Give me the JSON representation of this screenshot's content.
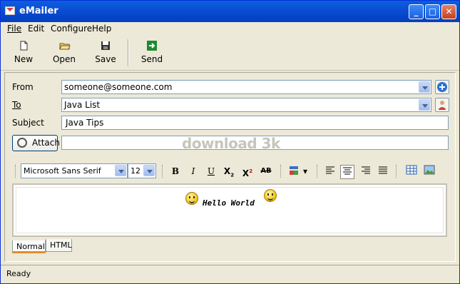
{
  "window": {
    "title": "eMailer"
  },
  "menu": [
    "File",
    "Edit",
    "Configure",
    "Help"
  ],
  "toolbar": {
    "new": "New",
    "open": "Open",
    "save": "Save",
    "send": "Send"
  },
  "form": {
    "from_label": "From",
    "from_value": "someone@someone.com",
    "to_label": "To",
    "to_value": "Java List",
    "subject_label": "Subject",
    "subject_value": "Java Tips",
    "attach_label": "Attach",
    "attach_value": ""
  },
  "watermark": "download 3k",
  "editor_toolbar": {
    "font": "Microsoft Sans Serif",
    "size": "12",
    "bold": "B",
    "italic": "I",
    "underline": "U",
    "subscript": "X",
    "subscript_mark": "2",
    "superscript": "X",
    "superscript_mark": "2",
    "strike": "AB"
  },
  "editor": {
    "content": "Hello World"
  },
  "tabs": [
    "Normal",
    "HTML"
  ],
  "status": "Ready"
}
